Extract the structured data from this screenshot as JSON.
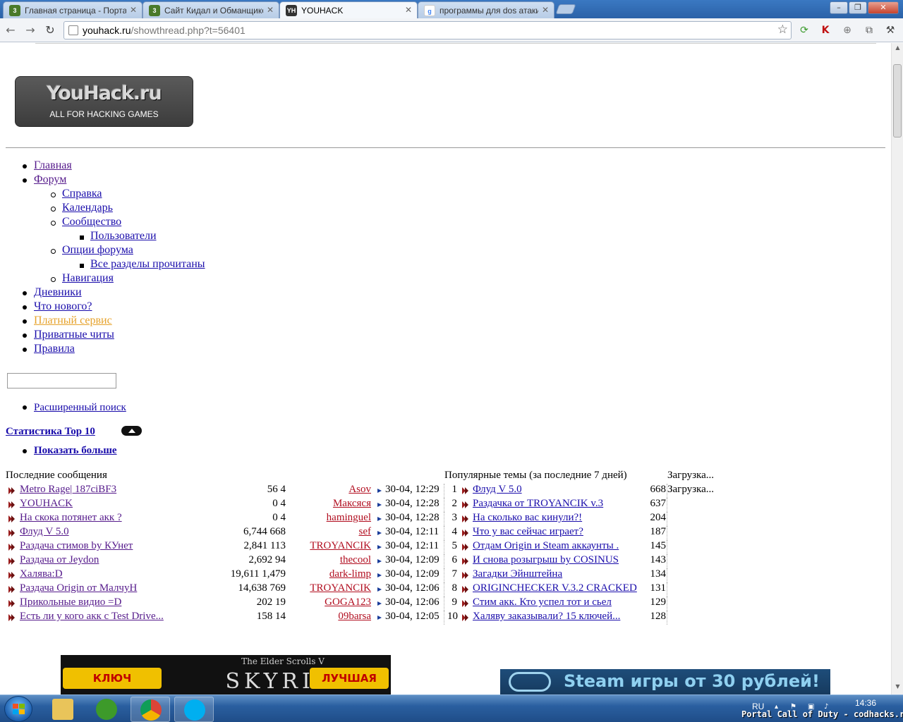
{
  "browser": {
    "tabs": [
      {
        "title": "Главная страница - Порта",
        "favicon": "codhacks-icon",
        "active": false
      },
      {
        "title": "Сайт Кидал и Обманщико",
        "favicon": "codhacks-icon",
        "active": false
      },
      {
        "title": "YOUHACK",
        "favicon": "youhack-icon",
        "active": true
      },
      {
        "title": "программы для dos атаки",
        "favicon": "google-icon",
        "active": false
      }
    ],
    "url_host": "youhack.ru",
    "url_path": "/showthread.php?t=56401"
  },
  "site": {
    "logo_title": "YouHack.ru",
    "logo_subtitle": "ALL FOR HACKING GAMES"
  },
  "menu": {
    "home": "Главная",
    "forum": "Форум",
    "help": "Справка",
    "calendar": "Календарь",
    "community": "Сообщество",
    "users": "Пользователи",
    "forum_options": "Опции форума",
    "mark_read": "Все разделы прочитаны",
    "navigation": "Навигация",
    "blogs": "Дневники",
    "whats_new": "Что нового?",
    "paid": "Платный сервис",
    "private_cheats": "Приватные читы",
    "rules": "Правила"
  },
  "search": {
    "value": "",
    "advanced": "Расширенный поиск"
  },
  "stats": {
    "title": "Статистика Top 10",
    "show_more": "Показать больше",
    "latest_header": "Последние сообщения",
    "popular_header": "Популярные темы (за последние 7 дней)",
    "loading_header": "Загрузка...",
    "loading_row": "Загрузка...",
    "latest": [
      {
        "title": "Metro Rage| 187ciBF3",
        "views": "56",
        "replies": "4",
        "user": "Asov",
        "time": "30-04, 12:29"
      },
      {
        "title": "YOUHACK",
        "views": "0",
        "replies": "4",
        "user": "Максяся",
        "time": "30-04, 12:28"
      },
      {
        "title": "На скока потянет акк ?",
        "views": "0",
        "replies": "4",
        "user": "haminguel",
        "time": "30-04, 12:28"
      },
      {
        "title": "Флуд V 5.0",
        "views": "6,744",
        "replies": "668",
        "user": "sef",
        "time": "30-04, 12:11"
      },
      {
        "title": "Раздача стимов by КУнет",
        "views": "2,841",
        "replies": "113",
        "user": "TROYANCIK",
        "time": "30-04, 12:11"
      },
      {
        "title": "Раздача от Jeydon",
        "views": "2,692",
        "replies": "94",
        "user": "thecool",
        "time": "30-04, 12:09"
      },
      {
        "title": "Халява:D",
        "views": "19,611",
        "replies": "1,479",
        "user": "dark-limp",
        "time": "30-04, 12:09"
      },
      {
        "title": "Раздача Origin от МалчуН",
        "views": "14,638",
        "replies": "769",
        "user": "TROYANCIK",
        "time": "30-04, 12:06"
      },
      {
        "title": "Прикольные видио =D",
        "views": "202",
        "replies": "19",
        "user": "GOGA123",
        "time": "30-04, 12:06"
      },
      {
        "title": "Есть ли у кого акк с Test Drive...",
        "views": "158",
        "replies": "14",
        "user": "09barsa",
        "time": "30-04, 12:05"
      }
    ],
    "popular": [
      {
        "rank": "1",
        "title": "Флуд V 5.0",
        "count": "668"
      },
      {
        "rank": "2",
        "title": "Раздачка от TROYANCIK v.3",
        "count": "637"
      },
      {
        "rank": "3",
        "title": "На сколько вас кинули?!",
        "count": "204"
      },
      {
        "rank": "4",
        "title": "Что у вас сейчас играет?",
        "count": "187"
      },
      {
        "rank": "5",
        "title": "Отдам Origin и Steam аккаунты .",
        "count": "145"
      },
      {
        "rank": "6",
        "title": "И снова розыгрыш by COSINUS",
        "count": "143"
      },
      {
        "rank": "7",
        "title": "Загадки Эйнштейна",
        "count": "134"
      },
      {
        "rank": "8",
        "title": "ORIGINCHECKER V.3.2 CRACKED",
        "count": "131"
      },
      {
        "rank": "9",
        "title": "Стим акк. Кто успел тот и сьел",
        "count": "129"
      },
      {
        "rank": "10",
        "title": "Халяву заказывали? 15 ключей...",
        "count": "128"
      }
    ]
  },
  "banners": {
    "skyrim_left": "КЛЮЧ АКТИВАЦИИ",
    "skyrim_series": "The Elder Scrolls V",
    "skyrim_title": "SKYRIM",
    "skyrim_right": "ЛУЧШАЯ ЦЕНА",
    "steam_text": "Steam игры от 30 рублей!"
  },
  "taskbar": {
    "lang": "RU",
    "time": "14:36"
  },
  "watermark": "Portal Call of Duty - codhacks.ru"
}
